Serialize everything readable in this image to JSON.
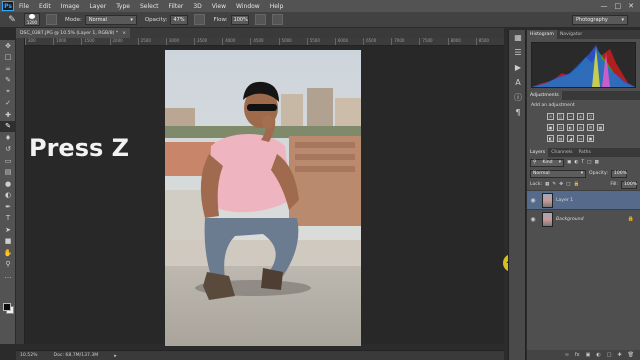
{
  "menu": {
    "logo": "Ps",
    "items": [
      "File",
      "Edit",
      "Image",
      "Layer",
      "Type",
      "Select",
      "Filter",
      "3D",
      "View",
      "Window",
      "Help"
    ]
  },
  "options": {
    "brush_size": "1200",
    "mode_label": "Mode:",
    "mode_value": "Normal",
    "opacity_label": "Opacity:",
    "opacity_value": "47%",
    "flow_label": "Flow:",
    "flow_value": "100%",
    "workspace": "Photography"
  },
  "document": {
    "tab_title": "DSC_0387.JPG @ 10.5% (Layer 1, RGB/8) *",
    "ruler_marks": [
      "300",
      "1000",
      "1500",
      "2000",
      "2500",
      "3000",
      "3500",
      "4000",
      "4500",
      "5000",
      "5500",
      "6000",
      "6500",
      "7000",
      "7500",
      "8000",
      "8500"
    ],
    "caption": "Press Z"
  },
  "status": {
    "zoom": "10.52%",
    "doc": "Doc: 68.7M/137.3M"
  },
  "panels": {
    "top_tabs": [
      "Histogram",
      "Navigator"
    ],
    "adjust_tab": "Adjustments",
    "adjust_title": "Add an adjustment",
    "layer_tabs": [
      "Layers",
      "Channels",
      "Paths"
    ],
    "kind_label": "Kind",
    "blend_mode": "Normal",
    "opacity_label": "Opacity:",
    "opacity_value": "100%",
    "lock_label": "Lock:",
    "fill_label": "Fill:",
    "fill_value": "100%",
    "layers": [
      {
        "name": "Layer 1",
        "selected": true
      },
      {
        "name": "Background",
        "selected": false
      }
    ]
  }
}
